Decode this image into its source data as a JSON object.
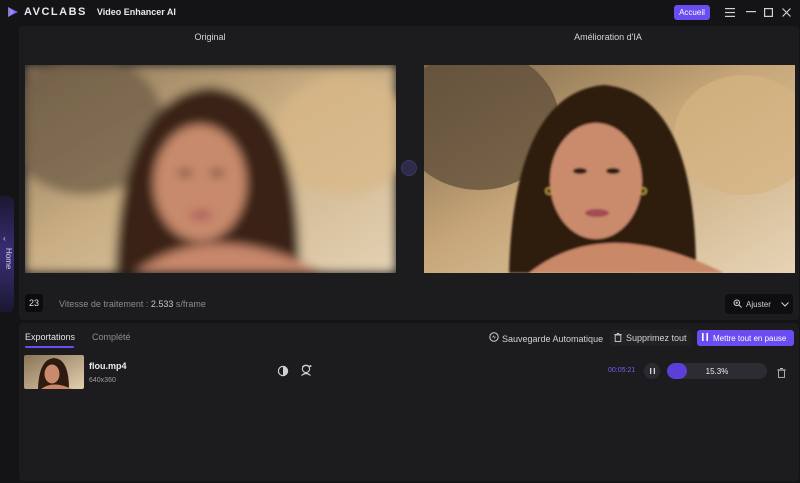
{
  "titlebar": {
    "brand": "AVCLABS",
    "product": "Video Enhancer AI",
    "home_button": "Accueil"
  },
  "side_tab": {
    "label": "Home"
  },
  "preview": {
    "original_label": "Original",
    "enhanced_label": "Amélioration d'IA",
    "frame_number": "23",
    "speed_prefix": "Vitesse de traitement : ",
    "speed_value": "2.533",
    "speed_unit": " s/frame",
    "fit_button": "Ajuster"
  },
  "exports": {
    "tabs": [
      "Exportations",
      "Complété"
    ],
    "auto_save": "Sauvegarde Automatique",
    "delete_all": "Supprimez tout",
    "pause_all": "Mettre tout en pause",
    "items": [
      {
        "filename": "flou.mp4",
        "resolution": "640x360",
        "time": "00:05:21",
        "progress": 0.153,
        "progress_label": "15.3%"
      }
    ]
  },
  "colors": {
    "accent": "#6a4cf0",
    "progress_fill": "#5b3fd8",
    "time_text": "#7b5cf2"
  },
  "icons": {
    "logo": "avclabs-logo-icon",
    "menu": "hamburger-menu-icon",
    "minimize": "minimize-icon",
    "maximize": "maximize-icon",
    "close": "close-icon",
    "auto_save": "auto-save-icon",
    "delete": "trash-icon",
    "pause": "pause-icon",
    "contrast": "contrast-icon",
    "face": "face-enhance-icon",
    "zoom": "zoom-icon"
  }
}
